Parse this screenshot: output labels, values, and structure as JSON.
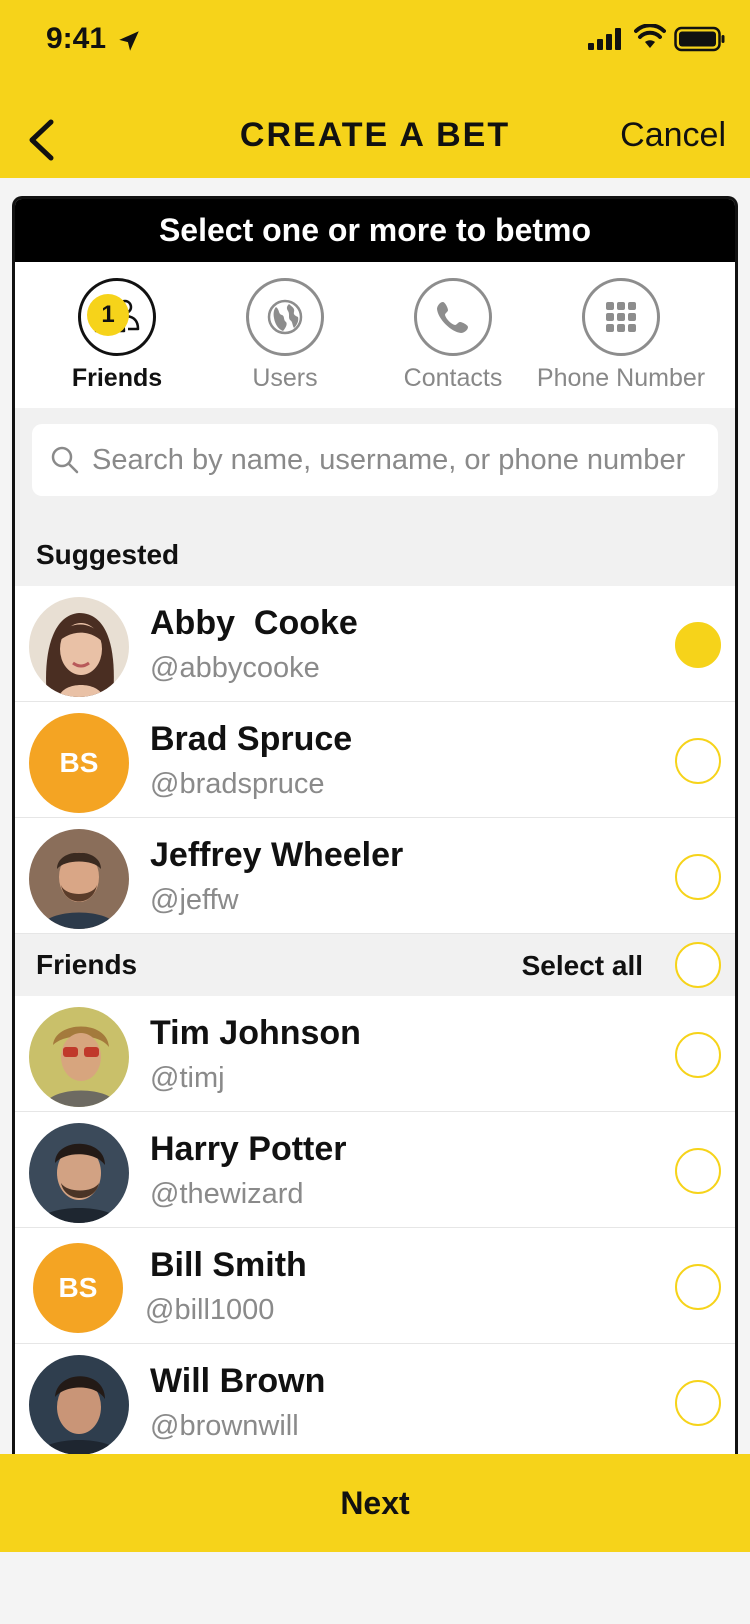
{
  "status_bar": {
    "time": "9:41"
  },
  "nav": {
    "title": "CREATE A BET",
    "cancel_label": "Cancel"
  },
  "card": {
    "header": "Select one or more to betmo"
  },
  "tabs": [
    {
      "label": "Friends",
      "badge": "1",
      "icon": "friends-icon",
      "active": true
    },
    {
      "label": "Users",
      "icon": "globe-icon",
      "active": false
    },
    {
      "label": "Contacts",
      "icon": "phone-icon",
      "active": false
    },
    {
      "label": "Phone Number",
      "icon": "keypad-icon",
      "active": false
    }
  ],
  "search": {
    "placeholder": "Search by name, username, or phone number"
  },
  "sections": {
    "suggested": {
      "title": "Suggested"
    },
    "friends": {
      "title": "Friends",
      "select_all_label": "Select all"
    }
  },
  "suggested": [
    {
      "name": "Abby  Cooke",
      "handle": "@abbycooke",
      "selected": true
    },
    {
      "name": "Brad Spruce",
      "handle": "@bradspruce",
      "initials": "BS",
      "selected": false
    },
    {
      "name": "Jeffrey Wheeler",
      "handle": "@jeffw",
      "selected": false
    }
  ],
  "friends": [
    {
      "name": "Tim Johnson",
      "handle": "@timj",
      "selected": false
    },
    {
      "name": "Harry Potter",
      "handle": "@thewizard",
      "selected": false
    },
    {
      "name": "Bill Smith",
      "handle": "@bill1000",
      "initials": "BS",
      "selected": false
    },
    {
      "name": "Will Brown",
      "handle": "@brownwill",
      "selected": false
    }
  ],
  "footer": {
    "next_label": "Next"
  },
  "colors": {
    "accent": "#f6d31a",
    "initials_bg": "#f4a423",
    "header_bg": "#000000"
  }
}
